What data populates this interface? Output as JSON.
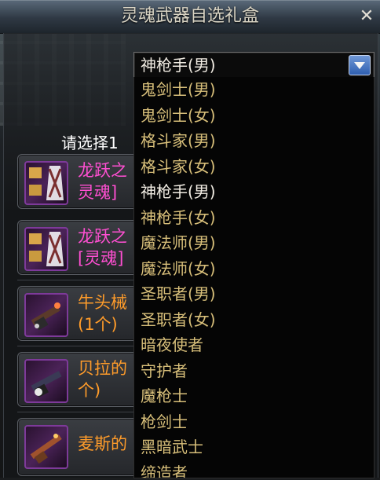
{
  "window": {
    "title": "灵魂武器自选礼盒",
    "close_label": "✕"
  },
  "prompt": "请选择1",
  "dropdown": {
    "selected": "神枪手(男)",
    "options": [
      "鬼剑士(男)",
      "鬼剑士(女)",
      "格斗家(男)",
      "格斗家(女)",
      "神枪手(男)",
      "神枪手(女)",
      "魔法师(男)",
      "魔法师(女)",
      "圣职者(男)",
      "圣职者(女)",
      "暗夜使者",
      "守护者",
      "魔枪士",
      "枪剑士",
      "黑暗武士",
      "缔造者"
    ],
    "selected_index": 4
  },
  "items": [
    {
      "name": "龙跃之\n灵魂]",
      "color": "#ff4fd2",
      "icon": "soul-crystal-icon"
    },
    {
      "name": "龙跃之\n[灵魂]",
      "color": "#ff4fd2",
      "icon": "soul-crystal-icon"
    },
    {
      "name": "牛头械\n(1个)",
      "color": "#ff9c2a",
      "icon": "gun-weapon-icon"
    },
    {
      "name": "贝拉的\n个)",
      "color": "#ff9c2a",
      "icon": "gun-weapon-icon"
    },
    {
      "name": "麦斯的",
      "color": "#ff9c2a",
      "icon": "rifle-weapon-icon"
    }
  ]
}
